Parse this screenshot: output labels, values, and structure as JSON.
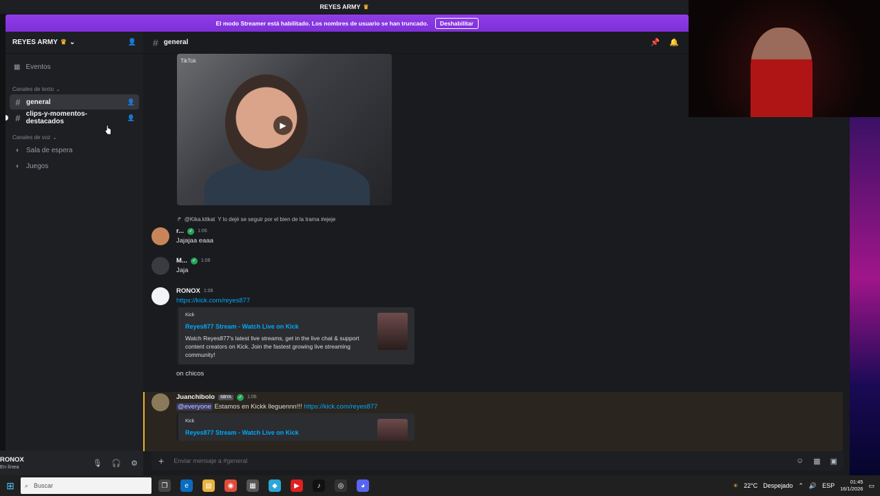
{
  "titlebar": {
    "title": "REYES ARMY"
  },
  "banner": {
    "text": "El modo Streamer está habilitado. Los nombres de usuario se han truncado.",
    "button": "Deshabilitar"
  },
  "server": {
    "name": "REYES ARMY",
    "events_label": "Eventos",
    "text_category": "Canales de texto",
    "text_channels": [
      "general",
      "clips-y-momentos-destacados"
    ],
    "voice_category": "Canales de voz",
    "voice_channels": [
      "Sala de espera",
      "Juegos"
    ]
  },
  "user": {
    "name": "RONOX",
    "status": "En línea"
  },
  "channel": {
    "name": "general"
  },
  "media": {
    "watermark": "TikTok"
  },
  "messages": {
    "reply": {
      "mention": "@Kika.kitkat",
      "text": "Y lo dejé se seguir por el bien de la trama #ejeje"
    },
    "m1": {
      "author": "r...",
      "time": "1:06",
      "text": "Jajajaa eaaa"
    },
    "m2": {
      "author": "M...",
      "time": "1:06",
      "text": "Jaja"
    },
    "m3": {
      "author": "RONOX",
      "time": "1:06",
      "link": "https://kick.com/reyes877",
      "embed": {
        "provider": "Kick",
        "title": "Reyes877 Stream - Watch Live on Kick",
        "description": "Watch Reyes877's latest live streams, get in the live chat & support content creators on Kick. Join the fastest growing live streaming community!"
      },
      "followup": "on chicos"
    },
    "m4": {
      "author": "Juanchibolo",
      "tag": "SBYA",
      "time": "1:06",
      "mention": "@everyone",
      "text": "Estamos en Kickk lleguennn!!!",
      "link": "https://kick.com/reyes877",
      "embed": {
        "provider": "Kick",
        "title": "Reyes877 Stream - Watch Live on Kick"
      }
    }
  },
  "composer": {
    "placeholder": "Enviar mensaje a #general"
  },
  "taskbar": {
    "search": "Buscar",
    "weather": "22°C",
    "weather_desc": "Despejado",
    "lang": "ESP",
    "time": "01:45",
    "date": "16/1/2026"
  },
  "colors": {
    "accent": "#5865f2",
    "banner": "#8f3ee6",
    "mention_highlight": "#f0b232"
  }
}
